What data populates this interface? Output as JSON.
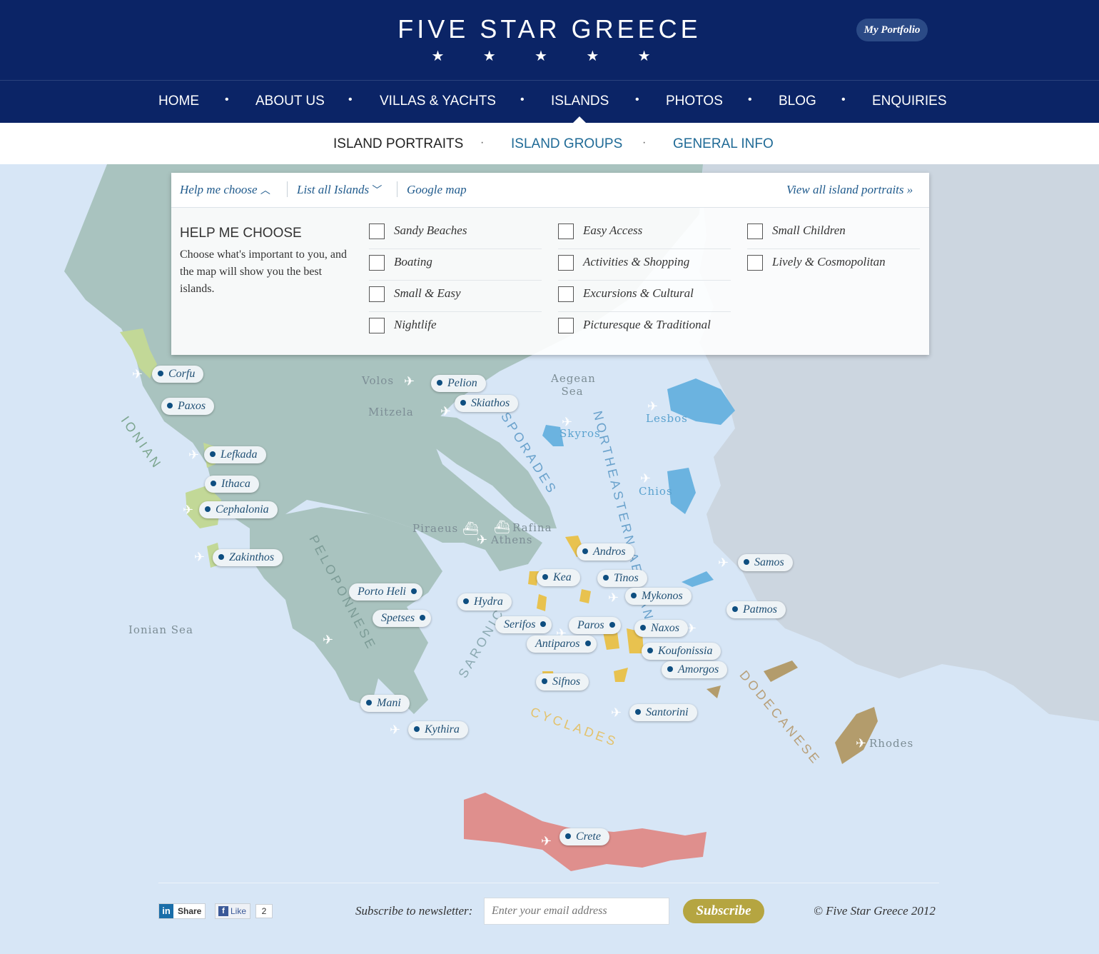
{
  "header": {
    "logo": "FIVE STAR GREECE",
    "stars": "★ ★ ★ ★ ★",
    "portfolio": "My Portfolio"
  },
  "nav": [
    "HOME",
    "ABOUT US",
    "VILLAS & YACHTS",
    "ISLANDS",
    "PHOTOS",
    "BLOG",
    "ENQUIRIES"
  ],
  "nav_active": "ISLANDS",
  "subnav": [
    "ISLAND PORTRAITS",
    "ISLAND GROUPS",
    "GENERAL INFO"
  ],
  "panel": {
    "help": "Help me choose",
    "list": "List all Islands",
    "google": "Google map",
    "view_all": "View all island portraits »",
    "title": "HELP ME CHOOSE",
    "description": "Choose what's important to you, and the map will show you the best islands.",
    "options": [
      "Sandy Beaches",
      "Boating",
      "Small & Easy",
      "Nightlife",
      "Easy Access",
      "Activities & Shopping",
      "Excursions & Cultural",
      "Picturesque & Traditional",
      "Small Children",
      "Lively & Cosmopolitan"
    ]
  },
  "map": {
    "colors": {
      "sea": "#d7e6f6",
      "land": "#a9c3bf",
      "turkey": "#cdd7df",
      "ionian": "#c2d897",
      "cyclades": "#e8c24f",
      "dodecanese": "#b39c6c",
      "crete": "#df8f8d",
      "northeast": "#6bb3e0"
    },
    "place_labels": [
      "Volos",
      "Mitzela",
      "Aegean Sea",
      "Lesbos",
      "Skyros",
      "Chios",
      "Piraeus",
      "Rafina",
      "Athens",
      "Ionian Sea",
      "Rhodes"
    ],
    "region_labels": [
      "IONIAN",
      "SPORADES",
      "NORTHEASTERN AEGEAN",
      "PELOPONNESE",
      "SARONIC",
      "CYCLADES",
      "DODECANESE"
    ],
    "islands": [
      "Corfu",
      "Paxos",
      "Lefkada",
      "Ithaca",
      "Cephalonia",
      "Zakinthos",
      "Pelion",
      "Skiathos",
      "Andros",
      "Kea",
      "Tinos",
      "Mykonos",
      "Samos",
      "Patmos",
      "Porto Heli",
      "Hydra",
      "Spetses",
      "Serifos",
      "Paros",
      "Naxos",
      "Antiparos",
      "Koufonissia",
      "Amorgos",
      "Sifnos",
      "Santorini",
      "Mani",
      "Kythira",
      "Crete"
    ]
  },
  "footer": {
    "linkedin": "Share",
    "facebook": "Like",
    "like_count": "2",
    "newsletter_label": "Subscribe to newsletter:",
    "email_placeholder": "Enter your email address",
    "subscribe_button": "Subscribe",
    "copyright": "© Five Star Greece 2012"
  }
}
